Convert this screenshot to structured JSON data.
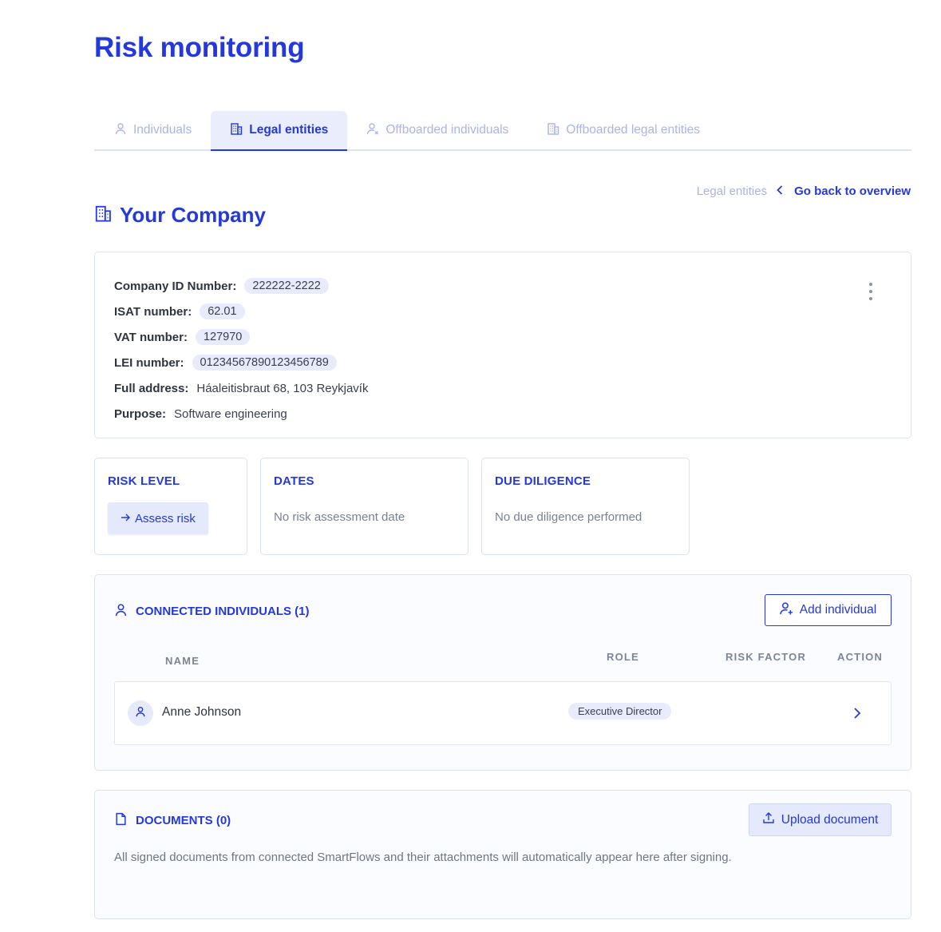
{
  "page": {
    "title": "Risk monitoring"
  },
  "tabs": [
    {
      "label": "Individuals",
      "icon": "user-icon",
      "active": false
    },
    {
      "label": "Legal entities",
      "icon": "building-icon",
      "active": true
    },
    {
      "label": "Offboarded individuals",
      "icon": "user-x-icon",
      "active": false
    },
    {
      "label": "Offboarded legal entities",
      "icon": "building-icon",
      "active": false
    }
  ],
  "breadcrumb": {
    "current": "Legal entities",
    "back_label": "Go back to overview"
  },
  "company": {
    "name": "Your Company",
    "fields": [
      {
        "label": "Company ID Number:",
        "value": "222222-2222",
        "pill": true
      },
      {
        "label": "ISAT number:",
        "value": "62.01",
        "pill": true
      },
      {
        "label": "VAT number:",
        "value": "127970",
        "pill": true
      },
      {
        "label": "LEI number:",
        "value": "01234567890123456789",
        "pill": true
      },
      {
        "label": "Full address:",
        "value": "Háaleitisbraut 68, 103 Reykjavík",
        "pill": false
      },
      {
        "label": "Purpose:",
        "value": "Software engineering",
        "pill": false
      }
    ]
  },
  "risk_level": {
    "title": "RISK LEVEL",
    "button": "Assess risk"
  },
  "dates": {
    "title": "DATES",
    "text": "No risk assessment date"
  },
  "due_diligence": {
    "title": "DUE DILIGENCE",
    "text": "No due diligence performed"
  },
  "connected": {
    "title": "CONNECTED INDIVIDUALS (1)",
    "add_button": "Add individual",
    "columns": {
      "name": "NAME",
      "role": "ROLE",
      "risk_factor": "RISK FACTOR",
      "action": "ACTION"
    },
    "rows": [
      {
        "name": "Anne Johnson",
        "role": "Executive Director",
        "risk_factor": ""
      }
    ]
  },
  "documents": {
    "title": "DOCUMENTS (0)",
    "upload_button": "Upload document",
    "empty_text": "All signed documents from connected SmartFlows and their attachments will automatically appear here after signing."
  },
  "colors": {
    "accent": "#2438e0",
    "accent_light": "#e7ebfb",
    "muted": "#aab4e8"
  }
}
